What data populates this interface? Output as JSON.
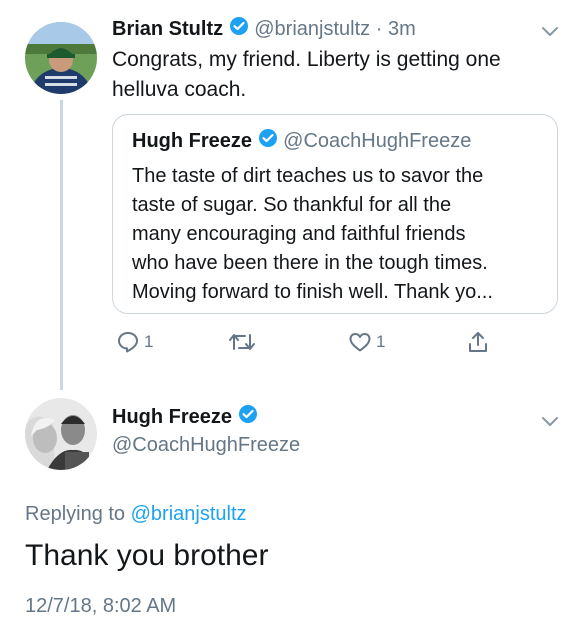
{
  "tweet1": {
    "name": "Brian Stultz",
    "handle": "@brianjstultz",
    "separator": "·",
    "time": "3m",
    "text_line1": "Congrats, my friend. Liberty is getting one",
    "text_line2": "helluva coach."
  },
  "quote": {
    "name": "Hugh Freeze",
    "handle": "@CoachHughFreeze",
    "lines": [
      "The taste of dirt teaches us to savor the",
      "taste of sugar. So thankful for all the",
      "many encouraging and faithful friends",
      "who have been there in the tough times.",
      "Moving forward to finish well. Thank yo..."
    ]
  },
  "actions": {
    "reply_count": "1",
    "like_count": "1"
  },
  "tweet2": {
    "name": "Hugh Freeze",
    "handle": "@CoachHughFreeze",
    "replying_prefix": "Replying to",
    "replying_handle": "@brianjstultz",
    "text": "Thank you brother",
    "timestamp": "12/7/18, 8:02 AM"
  },
  "icons": {
    "verified": "verified-badge-icon",
    "reply": "reply-icon",
    "retweet": "retweet-icon",
    "like": "heart-icon",
    "share": "share-icon",
    "more": "chevron-down-icon"
  },
  "colors": {
    "verified_blue": "#1da1f2",
    "link_blue": "#1da1f2",
    "muted": "#657786",
    "border": "#ccd6dd"
  }
}
